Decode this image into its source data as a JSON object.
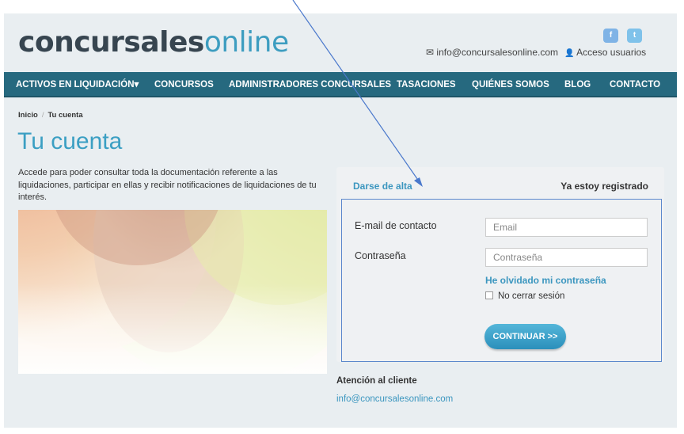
{
  "header": {
    "logo_bold": "concursales",
    "logo_light": "online",
    "facebook_glyph": "f",
    "twitter_glyph": "t",
    "mail_icon": "✉",
    "email": "info@concursalesonline.com",
    "user_icon": "👤",
    "access_label": "Acceso usuarios"
  },
  "nav": {
    "items": [
      "ACTIVOS EN LIQUIDACIÓN",
      "CONCURSOS",
      "ADMINISTRADORES CONCURSALES",
      "TASACIONES",
      "QUIÉNES SOMOS",
      "BLOG",
      "CONTACTO"
    ],
    "caret": "▾"
  },
  "breadcrumb": {
    "home": "Inicio",
    "separator": "/",
    "current": "Tu cuenta"
  },
  "page_title": "Tu cuenta",
  "intro_text": "Accede para poder consultar toda la documentación referente a las liquidaciones, participar en ellas y recibir notificaciones de liquidaciones de tu interés.",
  "account": {
    "tab_signup": "Darse de alta",
    "tab_login": "Ya estoy registrado",
    "email_label": "E-mail de contacto",
    "email_placeholder": "Email",
    "password_label": "Contraseña",
    "password_placeholder": "Contraseña",
    "forgot_link": "He olvidado mi contraseña",
    "remember_label": "No cerrar sesión",
    "submit_label": "CONTINUAR >>"
  },
  "support": {
    "title": "Atención al cliente",
    "email": "info@concursalesonline.com"
  },
  "colors": {
    "nav_bg": "#26697f",
    "accent": "#3b9fc3",
    "annotation_arrow": "#4a78cc"
  },
  "icons": [
    "facebook-icon",
    "twitter-icon",
    "envelope-icon",
    "user-icon",
    "caret-down-icon",
    "checkbox-icon"
  ]
}
